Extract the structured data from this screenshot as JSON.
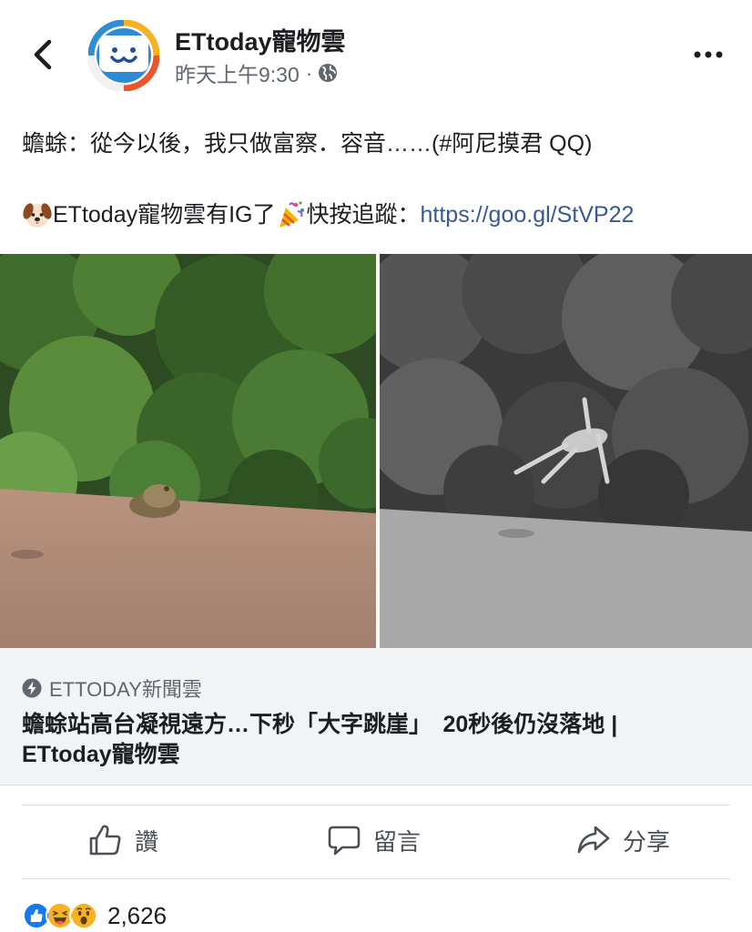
{
  "header": {
    "page_name": "ETtoday寵物雲",
    "timestamp": "昨天上午9:30",
    "separator": "·",
    "privacy_icon": "globe-icon",
    "back_icon": "chevron-left-icon",
    "more_icon": "more-dots-icon"
  },
  "post": {
    "line1": "蟾蜍：從今以後，我只做富察．容音……(#阿尼摸君 QQ)",
    "line2_before": "ETtoday寵物雲有IG了",
    "line2_after": "快按追蹤：",
    "link": "https://goo.gl/StVP22",
    "emoji_1": "dog-face-emoji",
    "emoji_2": "party-popper-emoji"
  },
  "link_card": {
    "source": "ETTODAY新聞雲",
    "source_icon": "lightning-bolt-icon",
    "title_line1": "蟾蜍站高台凝視遠方…下秒「大字跳崖」　20秒後仍沒落地 |",
    "title_line2": "ETtoday寵物雲"
  },
  "actions": {
    "like": "讚",
    "comment": "留言",
    "share": "分享"
  },
  "reactions": {
    "icons": [
      "like-reaction-icon",
      "haha-reaction-icon",
      "wow-reaction-icon"
    ],
    "count": "2,626"
  },
  "colors": {
    "link": "#385898",
    "meta_text": "#616770",
    "card_bg": "#f2f3f5",
    "like_blue": "#1877f2",
    "reaction_yellow": "#f7b125"
  }
}
